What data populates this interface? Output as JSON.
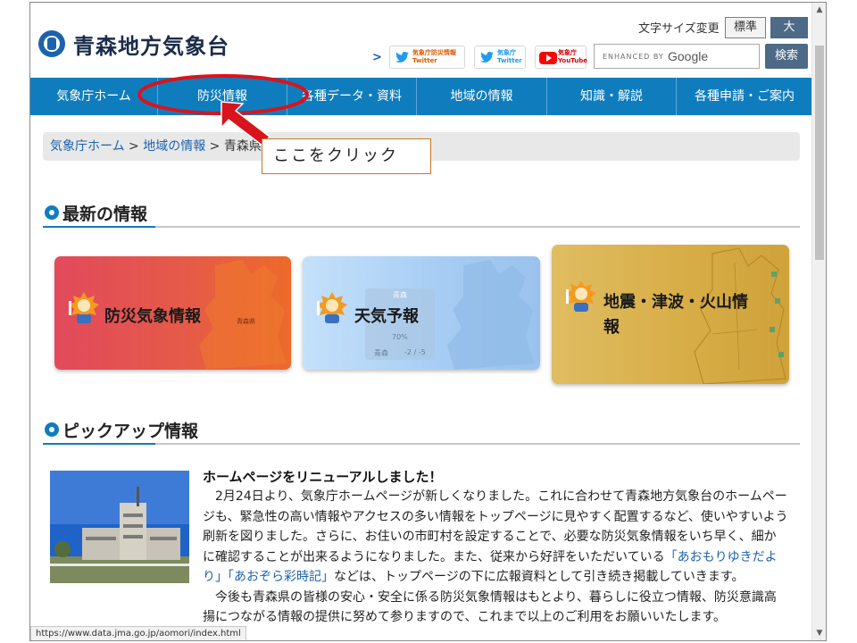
{
  "header": {
    "site_title": "青森地方気象台",
    "font_size_label": "文字サイズ変更",
    "font_size_normal": "標準",
    "font_size_large": "大",
    "sns": [
      {
        "line1": "気象庁防災情報",
        "line2": "Twitter"
      },
      {
        "line1": "気象庁",
        "line2": "Twitter"
      },
      {
        "line1": "気象庁",
        "line2": "YouTube"
      }
    ],
    "search_brand": "ENHANCED BY",
    "search_google": "Google",
    "search_button": "検索"
  },
  "nav": {
    "items": [
      {
        "label": "気象庁ホーム"
      },
      {
        "label": "防災情報"
      },
      {
        "label": "各種データ・資料"
      },
      {
        "label": "地域の情報"
      },
      {
        "label": "知識・解説"
      },
      {
        "label": "各種申請・ご案内"
      }
    ]
  },
  "breadcrumb": {
    "home": "気象庁ホーム",
    "sep1": " > ",
    "region": "地域の情報",
    "sep2": " > ",
    "current": "青森県"
  },
  "annotation": {
    "callout_text": "ここをクリック",
    "color": "#d9141c"
  },
  "sections": {
    "latest": "最新の情報",
    "pickup": "ピックアップ情報"
  },
  "cards": [
    {
      "title": "防災気象情報",
      "map_label": "青森県"
    },
    {
      "title": "天気予報",
      "panel_title": "青森",
      "panel_pct": "70%",
      "panel_city": "青森",
      "panel_temp": "-2 / -5"
    },
    {
      "title_line1": "地震・津波・火山情",
      "title_line2": "報"
    }
  ],
  "pickup": {
    "title": "ホームページをリニューアルしました！",
    "p1_before": "　2月24日より、気象庁ホームページが新しくなりました。これに合わせて青森地方気象台のホームページも、緊急性の高い情報やアクセスの多い情報をトップページに見やすく配置するなど、使いやすいよう刷新を図りました。さらに、お住いの市町村を設定することで、必要な防災気象情報をいち早く、細かに確認することが出来るようになりました。また、従来から好評をいただいている",
    "link1": "「あおもりゆきだより」",
    "link2": "「あおぞら彩時記」",
    "p1_after": "などは、トップページの下に広報資料として引き続き掲載していきます。",
    "p2": "　今後も青森県の皆様の安心・安全に係る防災気象情報はもとより、暮らしに役立つ情報、防災意識高揚につながる情報の提供に努めて参りますので、これまで以上のご利用をお願いいたします。"
  },
  "status_url": "https://www.data.jma.go.jp/aomori/index.html",
  "colors": {
    "nav_blue": "#0f7dbd",
    "card_red": "#e2505a",
    "card_blue": "#a9d0f5",
    "card_gold": "#d9b24e"
  },
  "icons": [
    "jma-logo-icon",
    "chevron-right-icon",
    "twitter-bird-icon",
    "youtube-icon",
    "mascot-icon"
  ]
}
